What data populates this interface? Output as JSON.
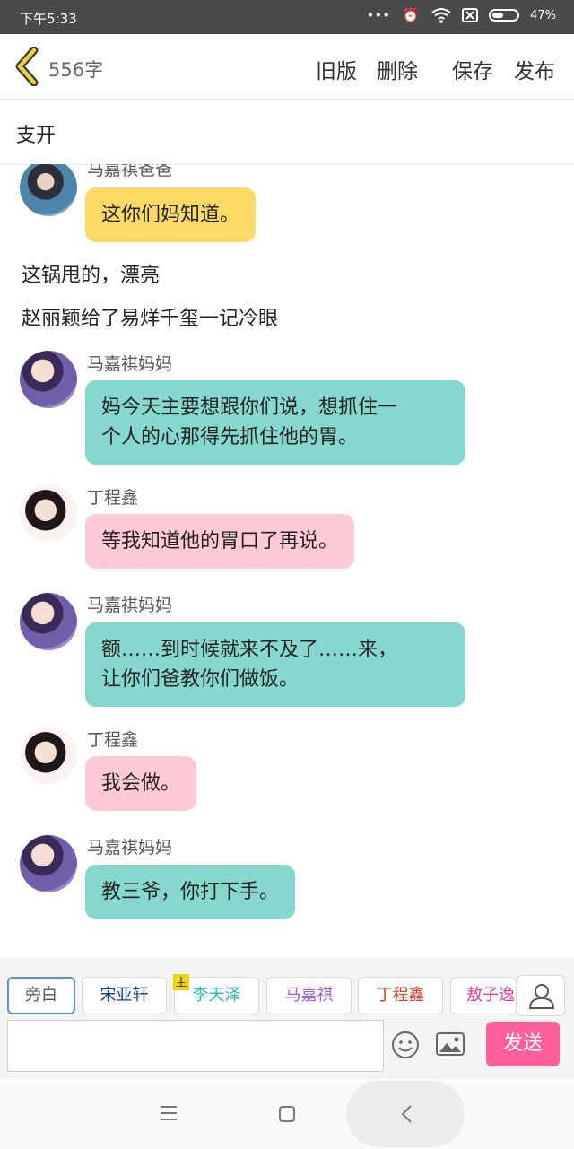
{
  "status_bar": {
    "time": "下午5:33",
    "dots": "•••",
    "battery": "47%"
  },
  "toolbar": {
    "word_count": "556字",
    "old_version": "旧版",
    "delete": "删除",
    "save": "保存",
    "publish": "发布"
  },
  "chapter_title": "支开",
  "messages": [
    {
      "type": "chat",
      "speaker": "马嘉祺爸爸",
      "avatar": "dad",
      "color": "yellow",
      "text": "这你们妈知道。"
    },
    {
      "type": "narration",
      "text": "这锅甩的，漂亮"
    },
    {
      "type": "narration",
      "text": "赵丽颖给了易烊千玺一记冷眼"
    },
    {
      "type": "chat",
      "speaker": "马嘉祺妈妈",
      "avatar": "mom",
      "color": "teal",
      "lines": [
        "妈今天主要想跟你们说，想抓住一",
        "个人的心那得先抓住他的胃。"
      ]
    },
    {
      "type": "chat",
      "speaker": "丁程鑫",
      "avatar": "ding",
      "color": "pink",
      "text": "等我知道他的胃口了再说。"
    },
    {
      "type": "chat",
      "speaker": "马嘉祺妈妈",
      "avatar": "mom",
      "color": "teal",
      "lines": [
        "额……到时候就来不及了……来，",
        "让你们爸教你们做饭。"
      ]
    },
    {
      "type": "chat",
      "speaker": "丁程鑫",
      "avatar": "ding",
      "color": "pink",
      "text": "我会做。"
    },
    {
      "type": "chat",
      "speaker": "马嘉祺妈妈",
      "avatar": "mom",
      "color": "teal",
      "text": "教三爷，你打下手。"
    }
  ],
  "characters": [
    {
      "label": "旁白",
      "color": "#555555",
      "selected": true
    },
    {
      "label": "宋亚轩",
      "color": "#1a3a8a"
    },
    {
      "label": "李天泽",
      "color": "#2bb7a8",
      "badge": "主"
    },
    {
      "label": "马嘉祺",
      "color": "#a55bd8"
    },
    {
      "label": "丁程鑫",
      "color": "#e0402a"
    },
    {
      "label": "敖子逸",
      "color": "#e0409a"
    }
  ],
  "composer": {
    "send": "发送"
  },
  "icons": {
    "back": "chevron-left-icon",
    "emoji": "smiley-icon",
    "image": "image-icon",
    "person": "person-icon",
    "menu": "menu-icon",
    "home": "square-icon",
    "nav_back": "chevron-left-icon"
  }
}
